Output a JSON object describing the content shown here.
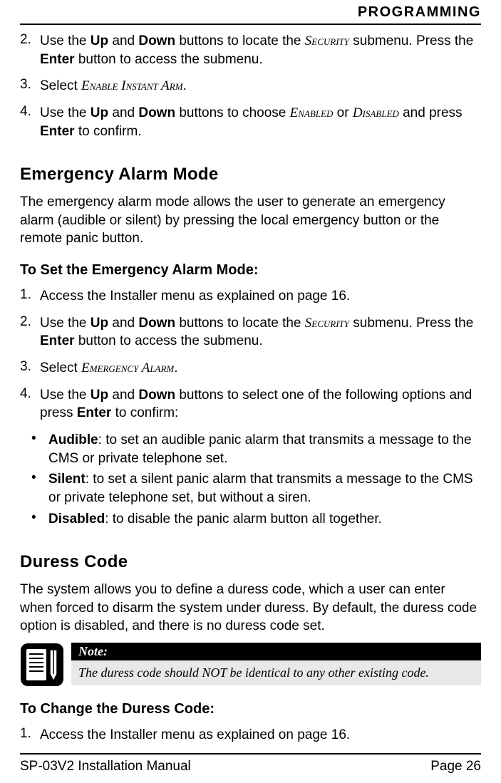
{
  "header": {
    "section": "PROGRAMMING"
  },
  "top_list": {
    "item2": {
      "num": "2.",
      "t1": "Use the ",
      "b1": "Up",
      "t2": " and ",
      "b2": "Down",
      "t3": " buttons to locate the ",
      "sc1": "Security",
      "t4": " submenu. Press the ",
      "b3": "Enter",
      "t5": " button to access the submenu."
    },
    "item3": {
      "num": "3.",
      "t1": "Select ",
      "sc1": "Enable Instant Arm",
      "t2": "."
    },
    "item4": {
      "num": "4.",
      "t1": "Use the ",
      "b1": "Up",
      "t2": " and ",
      "b2": "Down",
      "t3": " buttons to choose ",
      "sc1": "Enabled",
      "t4": " or ",
      "sc2": "Disabled",
      "t5": " and press ",
      "b3": "Enter",
      "t6": " to confirm."
    }
  },
  "emergency": {
    "heading": "Emergency Alarm Mode",
    "intro": "The emergency alarm mode allows the user to generate an emergency alarm (audible or silent) by pressing the local emergency button or the remote panic button.",
    "subheading": "To Set the Emergency Alarm Mode:",
    "item1": {
      "num": "1.",
      "text": "Access the Installer menu as explained on page 16."
    },
    "item2": {
      "num": "2.",
      "t1": "Use the ",
      "b1": "Up",
      "t2": " and ",
      "b2": "Down",
      "t3": " buttons to locate the ",
      "sc1": "Security",
      "t4": " submenu. Press the ",
      "b3": "Enter",
      "t5": " button to access the submenu."
    },
    "item3": {
      "num": "3.",
      "t1": "Select ",
      "sc1": "Emergency Alarm",
      "t2": "."
    },
    "item4": {
      "num": "4.",
      "t1": "Use the ",
      "b1": "Up",
      "t2": " and ",
      "b2": "Down",
      "t3": " buttons to select one of the following options and press ",
      "b3": "Enter",
      "t4": " to confirm:"
    },
    "bullets": {
      "a": {
        "b": "Audible",
        "rest": ": to set an audible panic alarm that transmits a message to the CMS or private telephone set."
      },
      "b": {
        "b": "Silent",
        "rest": ": to set a silent panic alarm that transmits a message to the CMS or private telephone set, but without a siren."
      },
      "c": {
        "b": "Disabled",
        "rest": ": to disable the panic alarm button all together."
      }
    }
  },
  "duress": {
    "heading": "Duress Code",
    "intro": "The system allows you to define a duress code, which a user can enter when forced to disarm the system under duress. By default, the duress code option is disabled, and there is no duress code set.",
    "note_label": "Note:",
    "note_body": "The duress code should NOT be identical to any other existing code.",
    "subheading": "To Change the Duress Code:",
    "item1": {
      "num": "1.",
      "text": "Access the Installer menu as explained on page 16."
    }
  },
  "footer": {
    "left": "SP-03V2 Installation Manual",
    "right": "Page 26"
  }
}
